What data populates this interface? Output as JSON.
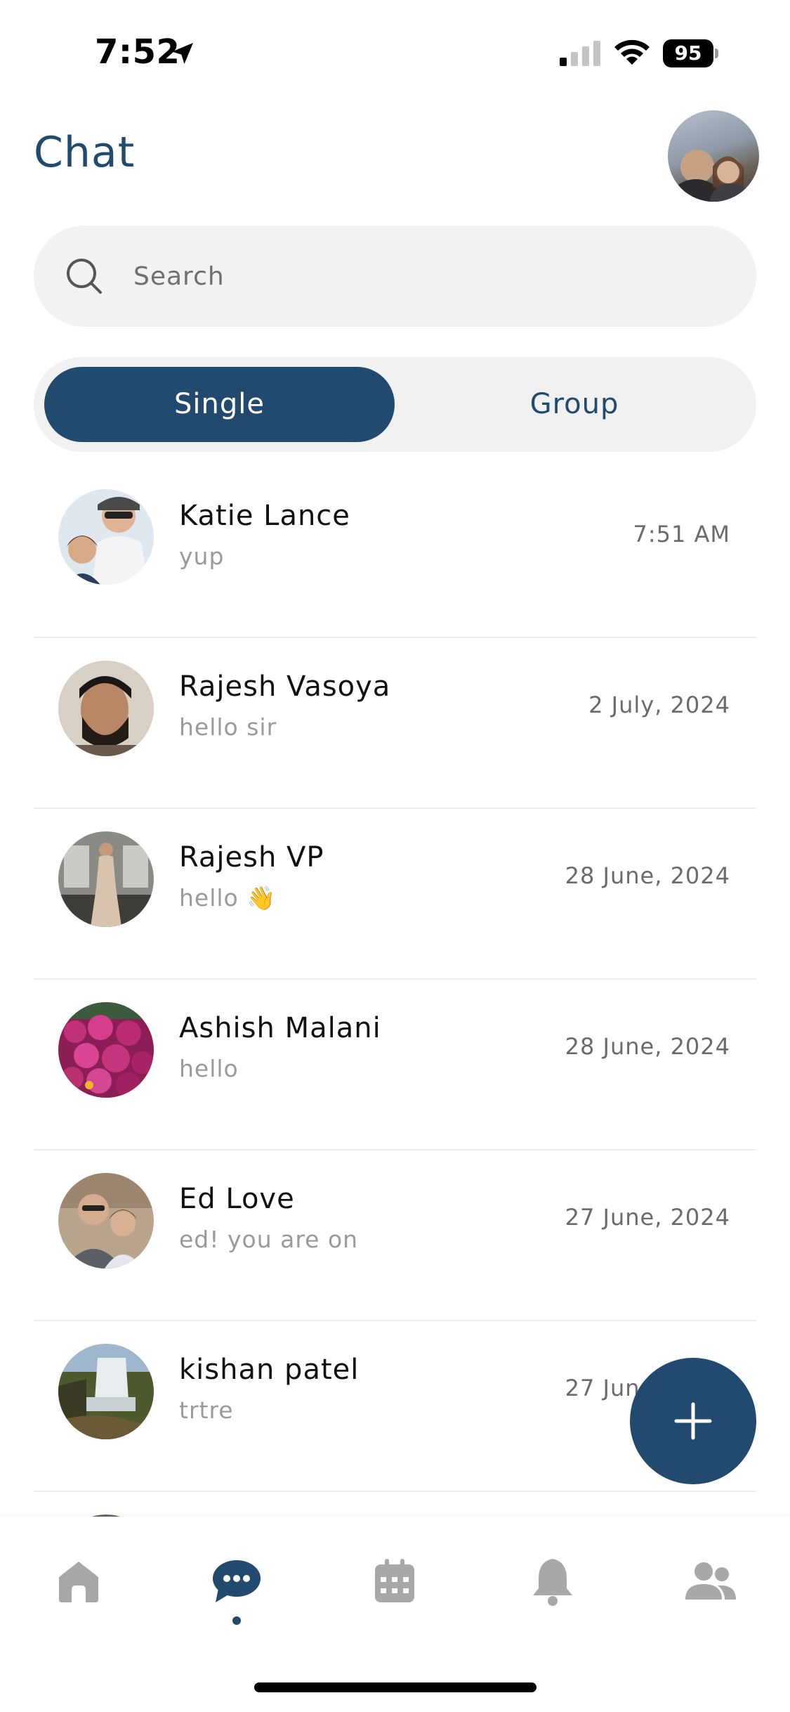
{
  "status_bar": {
    "time": "7:52",
    "battery": "95"
  },
  "header": {
    "title": "Chat"
  },
  "search": {
    "placeholder": "Search"
  },
  "tabs": {
    "single_label": "Single",
    "group_label": "Group",
    "selected": "Single"
  },
  "chats": [
    {
      "name": "Katie Lance",
      "message": "yup",
      "date": "7:51 AM"
    },
    {
      "name": "Rajesh Vasoya",
      "message": "hello sir",
      "date": "2 July, 2024"
    },
    {
      "name": "Rajesh VP",
      "message": "hello 👋",
      "date": "28 June, 2024"
    },
    {
      "name": "Ashish Malani",
      "message": "hello",
      "date": "28 June, 2024"
    },
    {
      "name": "Ed Love",
      "message": "ed! you are on",
      "date": "27 June, 2024"
    },
    {
      "name": "kishan patel",
      "message": "trtre",
      "date": "27 June, 2024"
    }
  ],
  "fab": {
    "icon": "plus-icon"
  },
  "bottom_nav": {
    "items": [
      "home-icon",
      "chat-icon",
      "calendar-icon",
      "bell-icon",
      "people-icon"
    ],
    "active": "chat-icon"
  },
  "colors": {
    "primary": "#214a6e",
    "secondary_text": "#9a9a9a",
    "nav_inactive": "#a8a8a8"
  }
}
